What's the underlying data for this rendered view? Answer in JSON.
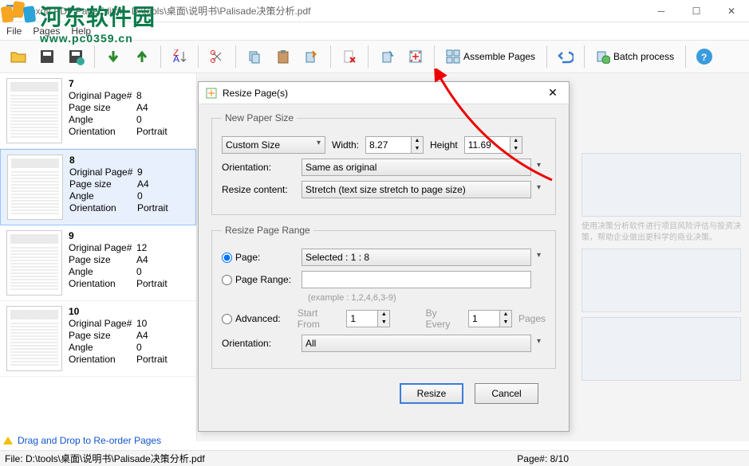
{
  "window": {
    "title": "Boxoft PDF PageEditor - D:\\tools\\桌面\\说明书\\Palisade决策分析.pdf"
  },
  "menu": {
    "file": "File",
    "pages": "Pages",
    "help": "Help"
  },
  "toolbar": {
    "assemble": "Assemble Pages",
    "batch": "Batch process"
  },
  "sidebar": {
    "items": [
      {
        "num": "7",
        "orig": "8",
        "size": "A4",
        "angle": "0",
        "orient": "Portrait"
      },
      {
        "num": "8",
        "orig": "9",
        "size": "A4",
        "angle": "0",
        "orient": "Portrait"
      },
      {
        "num": "9",
        "orig": "12",
        "size": "A4",
        "angle": "0",
        "orient": "Portrait"
      },
      {
        "num": "10",
        "orig": "10",
        "size": "A4",
        "angle": "0",
        "orient": "Portrait"
      }
    ],
    "labels": {
      "orig": "Original Page#",
      "size": "Page size",
      "angle": "Angle",
      "orient": "Orientation"
    },
    "drag_hint": "Drag and Drop to Re-order Pages"
  },
  "dialog": {
    "title": "Resize Page(s)",
    "paper_box": "New Paper Size",
    "paper_size": "Custom Size",
    "width_label": "Width:",
    "width_value": "8.27",
    "height_label": "Height",
    "height_value": "11.69",
    "orient_label": "Orientation:",
    "orient_value": "Same as original",
    "resize_content_label": "Resize content:",
    "resize_content_value": "Stretch (text size stretch to page size)",
    "range_box": "Resize Page Range",
    "page_radio": "Page:",
    "page_value": "Selected : 1 : 8",
    "range_radio": "Page Range:",
    "range_example": "(example : 1,2,4,6,3-9)",
    "adv_radio": "Advanced:",
    "start_from": "Start From",
    "start_value": "1",
    "by_every": "By Every",
    "every_value": "1",
    "pages_suffix": "Pages",
    "orient2_label": "Orientation:",
    "orient2_value": "All",
    "btn_resize": "Resize",
    "btn_cancel": "Cancel"
  },
  "status": {
    "file": "File: D:\\tools\\桌面\\说明书\\Palisade决策分析.pdf",
    "page": "Page#: 8/10"
  },
  "watermark": {
    "text": "河东软件园",
    "url": "www.pc0359.cn"
  }
}
